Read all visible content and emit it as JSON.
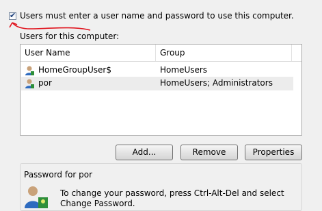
{
  "checkbox": {
    "label": "Users must enter a user name and password to use this computer.",
    "checked": true
  },
  "users_section": {
    "label": "Users for this computer:"
  },
  "list": {
    "columns": [
      "User Name",
      "Group"
    ],
    "rows": [
      {
        "name": "HomeGroupUser$",
        "group": "HomeUsers",
        "icon": "user-icon"
      },
      {
        "name": "por",
        "group": "HomeUsers; Administrators",
        "icon": "user-icon",
        "selected": true
      }
    ]
  },
  "buttons": {
    "add": "Add...",
    "remove": "Remove",
    "properties": "Properties"
  },
  "password_group": {
    "title": "Password for por",
    "text": "To change your password, press Ctrl-Alt-Del and select Change Password.",
    "icon": "user-keys-icon"
  },
  "colors": {
    "annotation": "#e0141e",
    "selection": "#ececec"
  }
}
